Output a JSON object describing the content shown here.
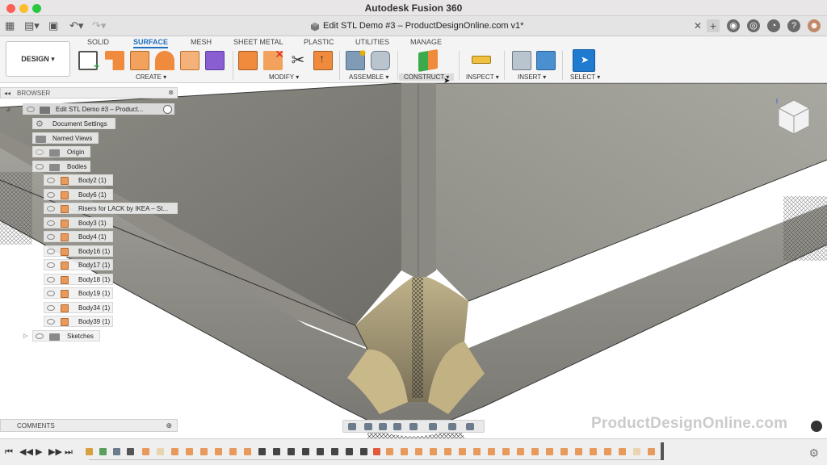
{
  "window": {
    "title": "Autodesk Fusion 360",
    "document_tab": "Edit STL Demo #3 – ProductDesignOnline.com v1*"
  },
  "toolbar": {
    "workspace": "DESIGN ▾",
    "tabs": [
      "SOLID",
      "SURFACE",
      "MESH",
      "SHEET METAL",
      "PLASTIC",
      "UTILITIES",
      "MANAGE"
    ],
    "active_tab": "SURFACE",
    "groups": [
      "CREATE ▾",
      "MODIFY ▾",
      "ASSEMBLE ▾",
      "CONSTRUCT ▾",
      "INSPECT ▾",
      "INSERT ▾",
      "SELECT ▾"
    ]
  },
  "browser": {
    "title": "BROWSER",
    "root": "Edit STL Demo #3 – Product...",
    "items": [
      "Document Settings",
      "Named Views",
      "Origin",
      "Bodies"
    ],
    "bodies": [
      "Body2 (1)",
      "Body6 (1)",
      "Risers for LACK by IKEA – St...",
      "Body3 (1)",
      "Body4 (1)",
      "Body16 (1)",
      "Body17 (1)",
      "Body18 (1)",
      "Body19 (1)",
      "Body34 (1)",
      "Body39 (1)"
    ],
    "sketches": "Sketches"
  },
  "comments": {
    "label": "COMMENTS"
  },
  "watermark": "ProductDesignOnline.com",
  "colors": {
    "accent": "#1f6fc0",
    "surface_tool": "#f08a3c",
    "body_icon": "#e89a5c",
    "model_gray": "#8f8c83",
    "fillet_tan": "#c9b88a"
  }
}
